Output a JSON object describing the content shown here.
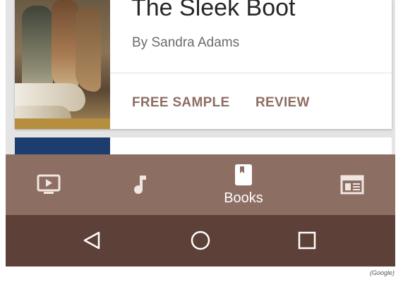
{
  "book": {
    "title": "The Sleek Boot",
    "author": "By Sandra Adams",
    "actions": {
      "free_sample": "FREE SAMPLE",
      "review": "REVIEW"
    },
    "colors": {
      "action_text": "#8d6e63"
    }
  },
  "bottom_nav": {
    "items": [
      {
        "icon": "tv-icon",
        "label": ""
      },
      {
        "icon": "music-note-icon",
        "label": ""
      },
      {
        "icon": "book-icon",
        "label": "Books",
        "active": true
      },
      {
        "icon": "newsstand-icon",
        "label": ""
      }
    ],
    "background": "#8d6e63"
  },
  "system_nav": {
    "buttons": [
      "back-icon",
      "home-icon",
      "recents-icon"
    ],
    "background": "#5d4037"
  },
  "credit": "(Google)"
}
